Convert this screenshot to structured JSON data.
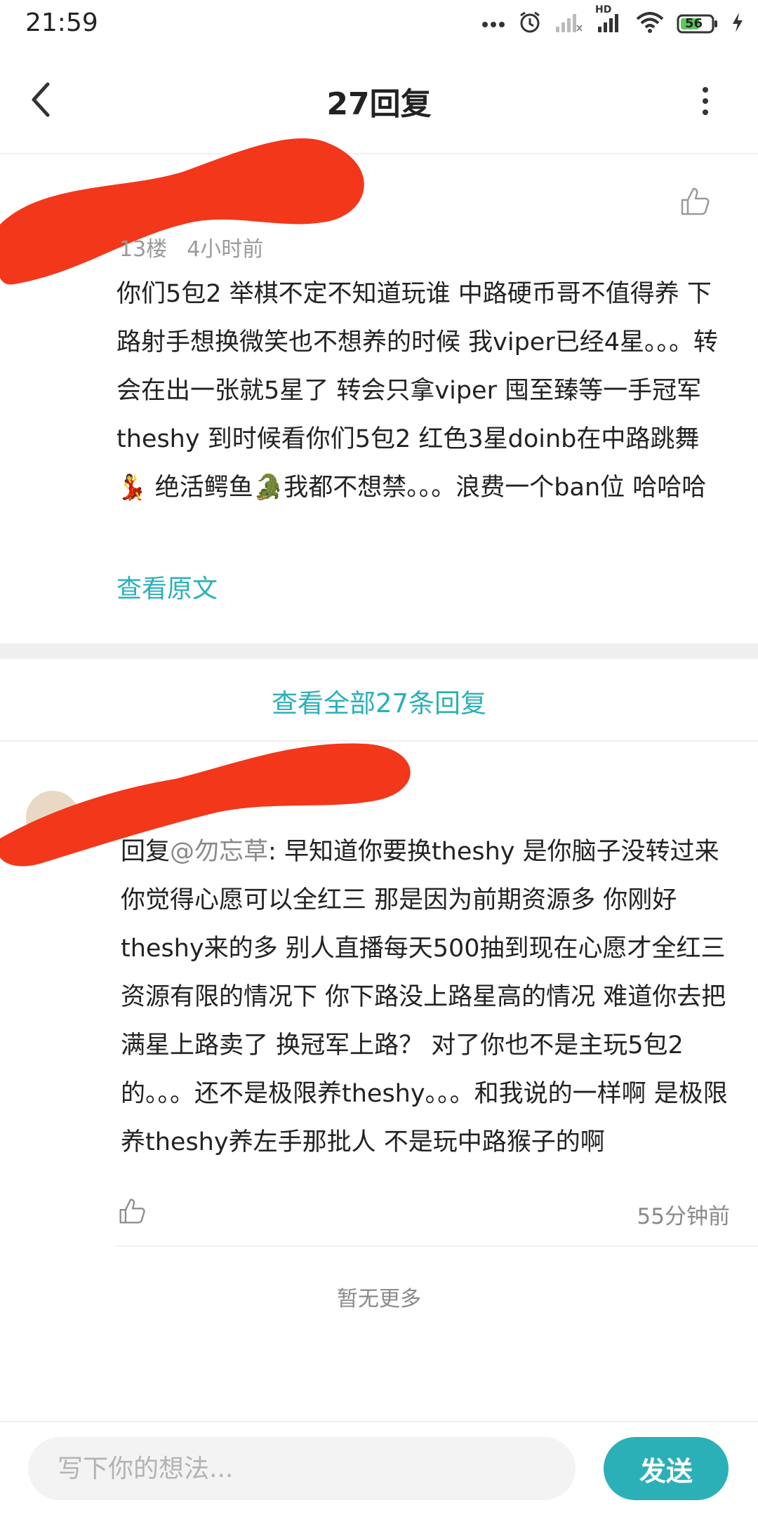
{
  "status_bar": {
    "time": "21:59",
    "battery": "56",
    "network_label": "HD",
    "icons": [
      "more-dots-icon",
      "alarm-icon",
      "no-signal-icon",
      "signal-icon",
      "wifi-icon",
      "battery-icon",
      "charging-icon"
    ]
  },
  "header": {
    "title": "27回复",
    "icons": [
      "back-chevron-icon",
      "more-vertical-icon"
    ]
  },
  "main_comment": {
    "floor": "13楼",
    "time": "4小时前",
    "text": "你们5包2 举棋不定不知道玩谁 中路硬币哥不值得养 下路射手想换微笑也不想养的时候 我viper已经4星。。。转会在出一张就5星了  转会只拿viper 囤至臻等一手冠军theshy   到时候看你们5包2 红色3星doinb在中路跳舞💃  绝活鳄鱼🐊我都不想禁。。。浪费一个ban位 哈哈哈",
    "view_original": "查看原文",
    "like_icon": "thumb-up-icon"
  },
  "view_all": "查看全部27条回复",
  "reply": {
    "prefix": "回复",
    "mention": "@勿忘草",
    "colon": ": ",
    "text": "早知道你要换theshy 是你脑子没转过来     你觉得心愿可以全红三 那是因为前期资源多 你刚好theshy来的多  别人直播每天500抽到现在心愿才全红三  资源有限的情况下  你下路没上路星高的情况 难道你去把满星上路卖了 换冠军上路？  对了你也不是主玩5包2的。。。还不是极限养theshy。。。和我说的一样啊 是极限养theshy养左手那批人 不是玩中路猴子的啊",
    "time": "55分钟前",
    "like_icon": "thumb-up-icon"
  },
  "no_more": "暂无更多",
  "composer": {
    "placeholder": "写下你的想法...",
    "send_label": "发送"
  },
  "colors": {
    "accent": "#2bb0b8",
    "redaction": "#f2371b"
  }
}
